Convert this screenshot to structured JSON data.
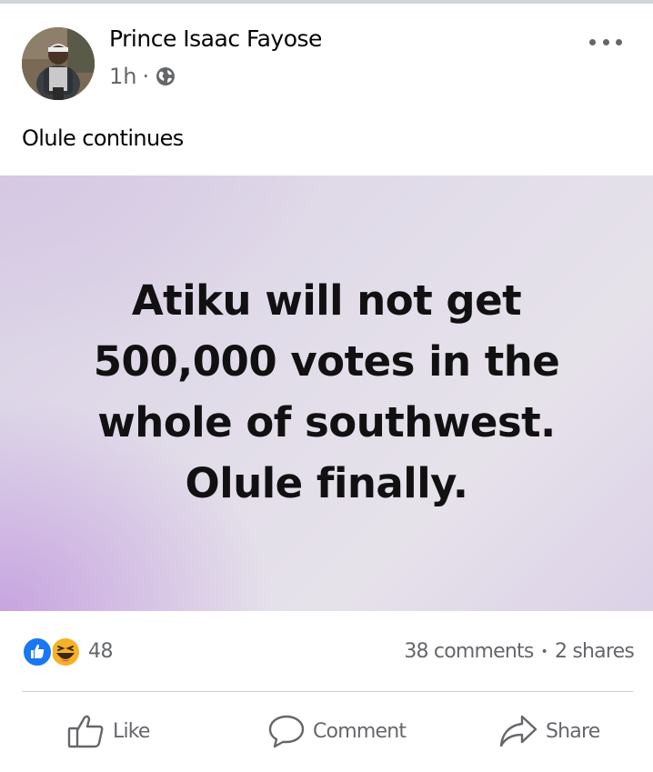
{
  "post": {
    "author": "Prince Isaac Fayose",
    "time": "1h",
    "separator": "·",
    "text": "Olule continues"
  },
  "image_text": {
    "lines": [
      "Atiku will not get",
      "500,000 votes in the",
      "whole of southwest.",
      "Olule finally."
    ]
  },
  "reactions": {
    "count": "48",
    "icons": [
      "like-icon",
      "haha-icon"
    ]
  },
  "stats": {
    "comments": "38 comments",
    "separator": "•",
    "shares": "2 shares"
  },
  "actions": {
    "like": "Like",
    "comment": "Comment",
    "share": "Share"
  },
  "colors": {
    "text": "#050505",
    "secondary": "#65676b",
    "like_blue": "#1877f2",
    "haha_yellow": "#f7b125"
  }
}
